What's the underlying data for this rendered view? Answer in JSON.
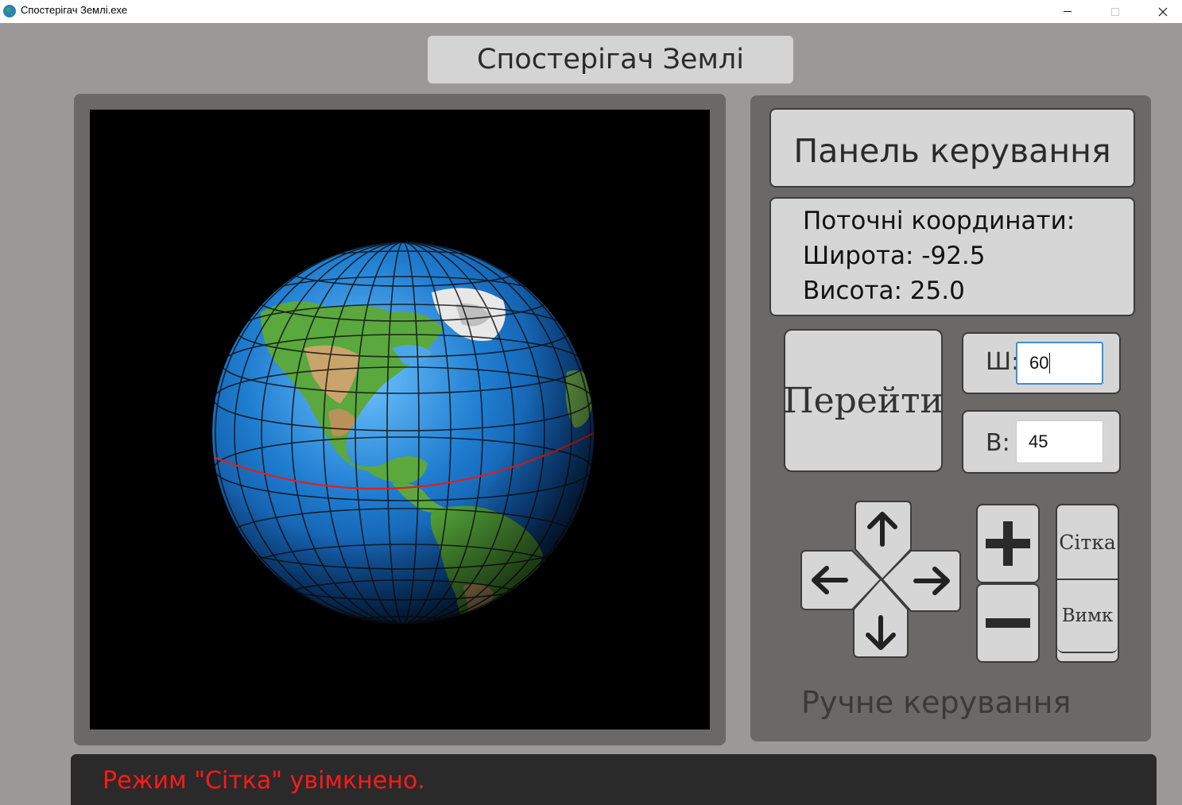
{
  "window": {
    "title": "Спостерігач Землі.exe",
    "app_icon": "globe-icon"
  },
  "header": {
    "title": "Спостерігач Землі"
  },
  "control_panel": {
    "title": "Панель керування",
    "coords": {
      "heading": "Поточні координати:",
      "latitude_line": "Широта: -92.5",
      "altitude_line": "Висота: 25.0"
    },
    "go_button": "Перейти",
    "lat_input": {
      "label": "Ш:",
      "value": "60"
    },
    "alt_input": {
      "label": "В:",
      "value": "45"
    },
    "dpad": {
      "up": "arrow-up-icon",
      "down": "arrow-down-icon",
      "left": "arrow-left-icon",
      "right": "arrow-right-icon"
    },
    "zoom_in_icon": "plus-icon",
    "zoom_out_icon": "minus-icon",
    "grid_on": "Сітка",
    "grid_off": "Вимк",
    "manual_label": "Ручне керування"
  },
  "status": {
    "text": "Режим \"Сітка\" увімкнено.",
    "color": "#ff1a1a"
  },
  "globe": {
    "grid_enabled": true,
    "equator_color": "#e0201c",
    "ocean_color": "#1f6fb5"
  }
}
